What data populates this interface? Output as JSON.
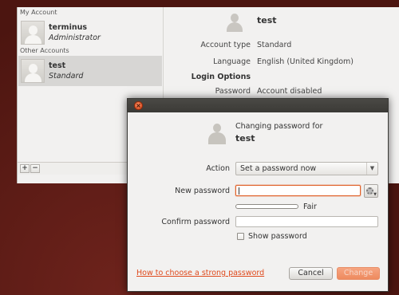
{
  "accounts": {
    "my_account_heading": "My Account",
    "other_accounts_heading": "Other Accounts",
    "users": [
      {
        "name": "terminus",
        "role": "Administrator"
      },
      {
        "name": "test",
        "role": "Standard"
      }
    ],
    "toolbar": {
      "add_label": "+",
      "remove_label": "−"
    },
    "detail": {
      "name": "test",
      "account_type_label": "Account type",
      "account_type_value": "Standard",
      "language_label": "Language",
      "language_value": "English (United Kingdom)",
      "login_options_heading": "Login Options",
      "password_label": "Password",
      "password_value": "Account disabled"
    }
  },
  "dialog": {
    "close_glyph": "×",
    "heading": "Changing password for",
    "user": "test",
    "action_label": "Action",
    "action_value": "Set a password now",
    "action_arrow": "▼",
    "new_password_label": "New password",
    "new_password_value": "",
    "strength_fraction": 0.0,
    "strength_label": "Fair",
    "confirm_password_label": "Confirm password",
    "confirm_password_value": "",
    "show_password_label": "Show password",
    "show_password_checked": false,
    "help_link": "How to choose a strong password",
    "cancel_label": "Cancel",
    "change_label": "Change",
    "generate_icon": "gear-icon"
  },
  "colors": {
    "accent": "#df4a1d",
    "desktop": "#5a1b16",
    "selection": "#d7d6d4"
  }
}
